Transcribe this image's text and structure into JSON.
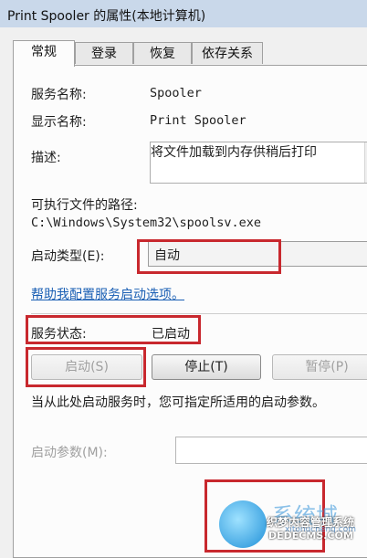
{
  "window": {
    "title": "Print Spooler 的属性(本地计算机)"
  },
  "tabs": [
    {
      "label": "常规",
      "active": true
    },
    {
      "label": "登录",
      "active": false
    },
    {
      "label": "恢复",
      "active": false
    },
    {
      "label": "依存关系",
      "active": false
    }
  ],
  "general": {
    "service_name_label": "服务名称:",
    "service_name_value": "Spooler",
    "display_name_label": "显示名称:",
    "display_name_value": "Print Spooler",
    "description_label": "描述:",
    "description_value": "将文件加载到内存供稍后打印",
    "exe_path_label": "可执行文件的路径:",
    "exe_path_value": "C:\\Windows\\System32\\spoolsv.exe",
    "startup_type_label": "启动类型(E):",
    "startup_type_value": "自动",
    "help_link": "帮助我配置服务启动选项。",
    "service_status_label": "服务状态:",
    "service_status_value": "已启动",
    "buttons": {
      "start": "启动(S)",
      "stop": "停止(T)",
      "pause": "暂停(P)"
    },
    "hint_text": "当从此处启动服务时，您可指定所适用的启动参数。",
    "start_params_label": "启动参数(M):",
    "start_params_value": ""
  },
  "watermark": {
    "brand": "系统城",
    "site": "xitongcheng.com",
    "overlay_line1": "织梦内容管理系统",
    "overlay_line2": "DEDECMS.COM"
  },
  "colors": {
    "annotation_red": "#c8282e",
    "link_blue": "#1a5fb4",
    "title_bar": "#c9d8ea"
  }
}
